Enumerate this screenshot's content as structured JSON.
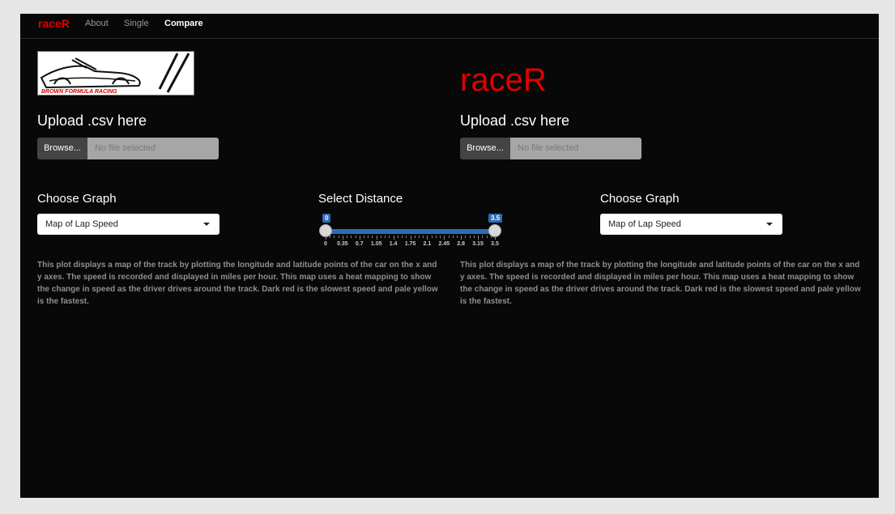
{
  "nav": {
    "brand": "raceR",
    "links": [
      "About",
      "Single",
      "Compare"
    ],
    "active": "Compare"
  },
  "logo": {
    "text": "BROWN FORMULA RACING"
  },
  "title": "raceR",
  "upload": {
    "left": {
      "heading": "Upload .csv here",
      "button": "Browse...",
      "placeholder": "No file selected"
    },
    "right": {
      "heading": "Upload .csv here",
      "button": "Browse...",
      "placeholder": "No file selected"
    }
  },
  "graph": {
    "left": {
      "heading": "Choose Graph",
      "selected": "Map of Lap Speed"
    },
    "right": {
      "heading": "Choose Graph",
      "selected": "Map of Lap Speed"
    }
  },
  "distance": {
    "heading": "Select Distance",
    "min": 0,
    "max": 3.5,
    "from": 0,
    "to": 3.5,
    "from_label": "0",
    "to_label": "3.5",
    "tick_labels": [
      "0",
      "0.35",
      "0.7",
      "1.05",
      "1.4",
      "1.75",
      "2.1",
      "2.45",
      "2.8",
      "3.15",
      "3.5"
    ]
  },
  "description": {
    "left": "This plot displays a map of the track by plotting the longitude and latitude points of the car on the x and y axes. The speed is recorded and displayed in miles per hour. This map uses a heat mapping to show the change in speed as the driver drives around the track. Dark red is the slowest speed and pale yellow is the fastest.",
    "right": "This plot displays a map of the track by plotting the longitude and latitude points of the car on the x and y axes. The speed is recorded and displayed in miles per hour. This map uses a heat mapping to show the change in speed as the driver drives around the track. Dark red is the slowest speed and pale yellow is the fastest."
  },
  "colors": {
    "brand": "#e00000",
    "accent": "#2d6db6",
    "background": "#080808"
  }
}
